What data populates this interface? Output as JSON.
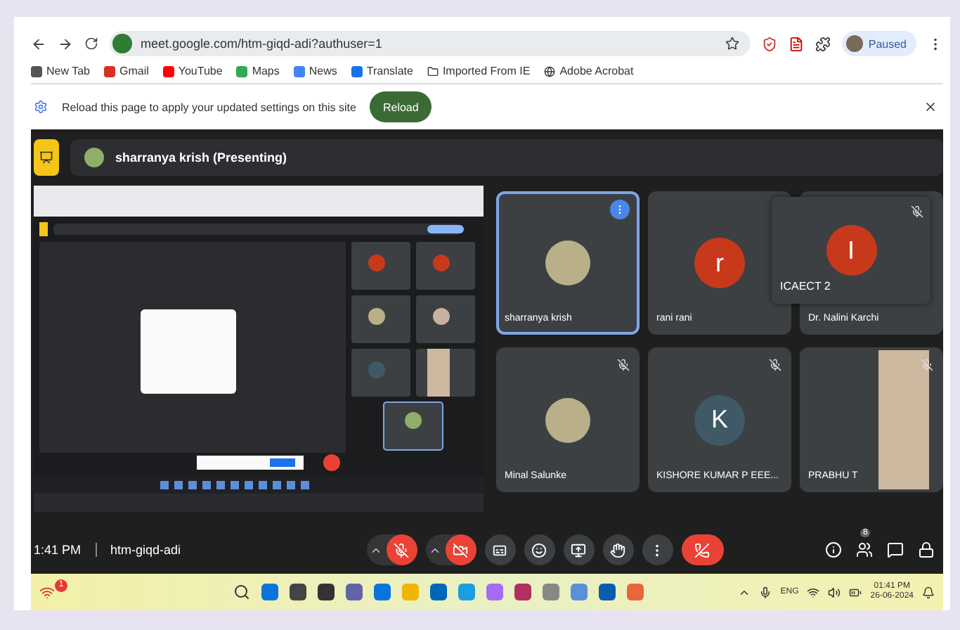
{
  "browser": {
    "url": "meet.google.com/htm-giqd-adi?authuser=1",
    "profile": "Paused",
    "bookmarks": [
      "New Tab",
      "Gmail",
      "YouTube",
      "Maps",
      "News",
      "Translate",
      "Imported From IE",
      "Adobe Acrobat"
    ],
    "infobar": {
      "message": "Reload this page to apply your updated settings on this site",
      "button": "Reload"
    }
  },
  "meet": {
    "presenter": "sharranya krish (Presenting)",
    "tiles": [
      {
        "name": "sharranya krish",
        "kind": "photo",
        "muted": false,
        "highlighted": true
      },
      {
        "name": "rani rani",
        "kind": "letter",
        "letter": "r",
        "color": "#c8391b",
        "muted": false,
        "highlighted": false
      },
      {
        "name": "Dr. Nalini Karchi",
        "kind": "none",
        "muted": false,
        "highlighted": false
      },
      {
        "name": "Minal Salunke",
        "kind": "photo",
        "muted": true,
        "highlighted": false
      },
      {
        "name": "KISHORE KUMAR P EEE...",
        "kind": "letter",
        "letter": "K",
        "color": "#3f5a66",
        "muted": true,
        "highlighted": false
      },
      {
        "name": "PRABHU T",
        "kind": "video",
        "muted": true,
        "highlighted": false
      }
    ],
    "floating_tile": {
      "name": "ICAECT 2",
      "letter": "I",
      "color": "#c8391b",
      "muted": true
    },
    "time": "1:41 PM",
    "meeting_code": "htm-giqd-adi",
    "controls": {
      "mic_on": false,
      "camera_on": false
    },
    "participants_count": "8"
  },
  "taskbar": {
    "notification_count": "1",
    "language": "ENG",
    "time": "01:41 PM",
    "date": "26-06-2024"
  }
}
